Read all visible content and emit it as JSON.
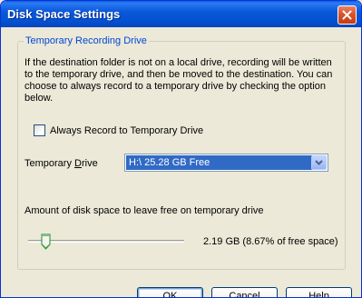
{
  "window": {
    "title": "Disk Space Settings"
  },
  "group": {
    "legend": "Temporary Recording Drive",
    "description": "If the destination folder is not on a local drive, recording will be written to the temporary drive, and then be moved to the destination. You can choose to always record to a temporary drive by checking the option below.",
    "always_record_label": "Always Record to Temporary Drive",
    "always_record_checked": false,
    "drive_label_pre": "Temporary ",
    "drive_label_underlined": "D",
    "drive_label_post": "rive",
    "drive_selected": "H:\\ 25.28 GB Free",
    "amount_label": "Amount of disk space to leave free on temporary drive",
    "slider_fraction": 0.0867,
    "free_space_text": "2.19 GB (8.67% of free space)"
  },
  "buttons": {
    "ok": "OK",
    "cancel": "Cancel",
    "help": "Help"
  },
  "colors": {
    "titlebar": "#0151d0",
    "legend": "#0046d5",
    "selection": "#316ac5",
    "dialog_bg": "#ece9d8"
  },
  "icons": {
    "close": "close-icon",
    "dropdown": "chevron-down-icon",
    "slider": "slider-thumb-icon"
  }
}
